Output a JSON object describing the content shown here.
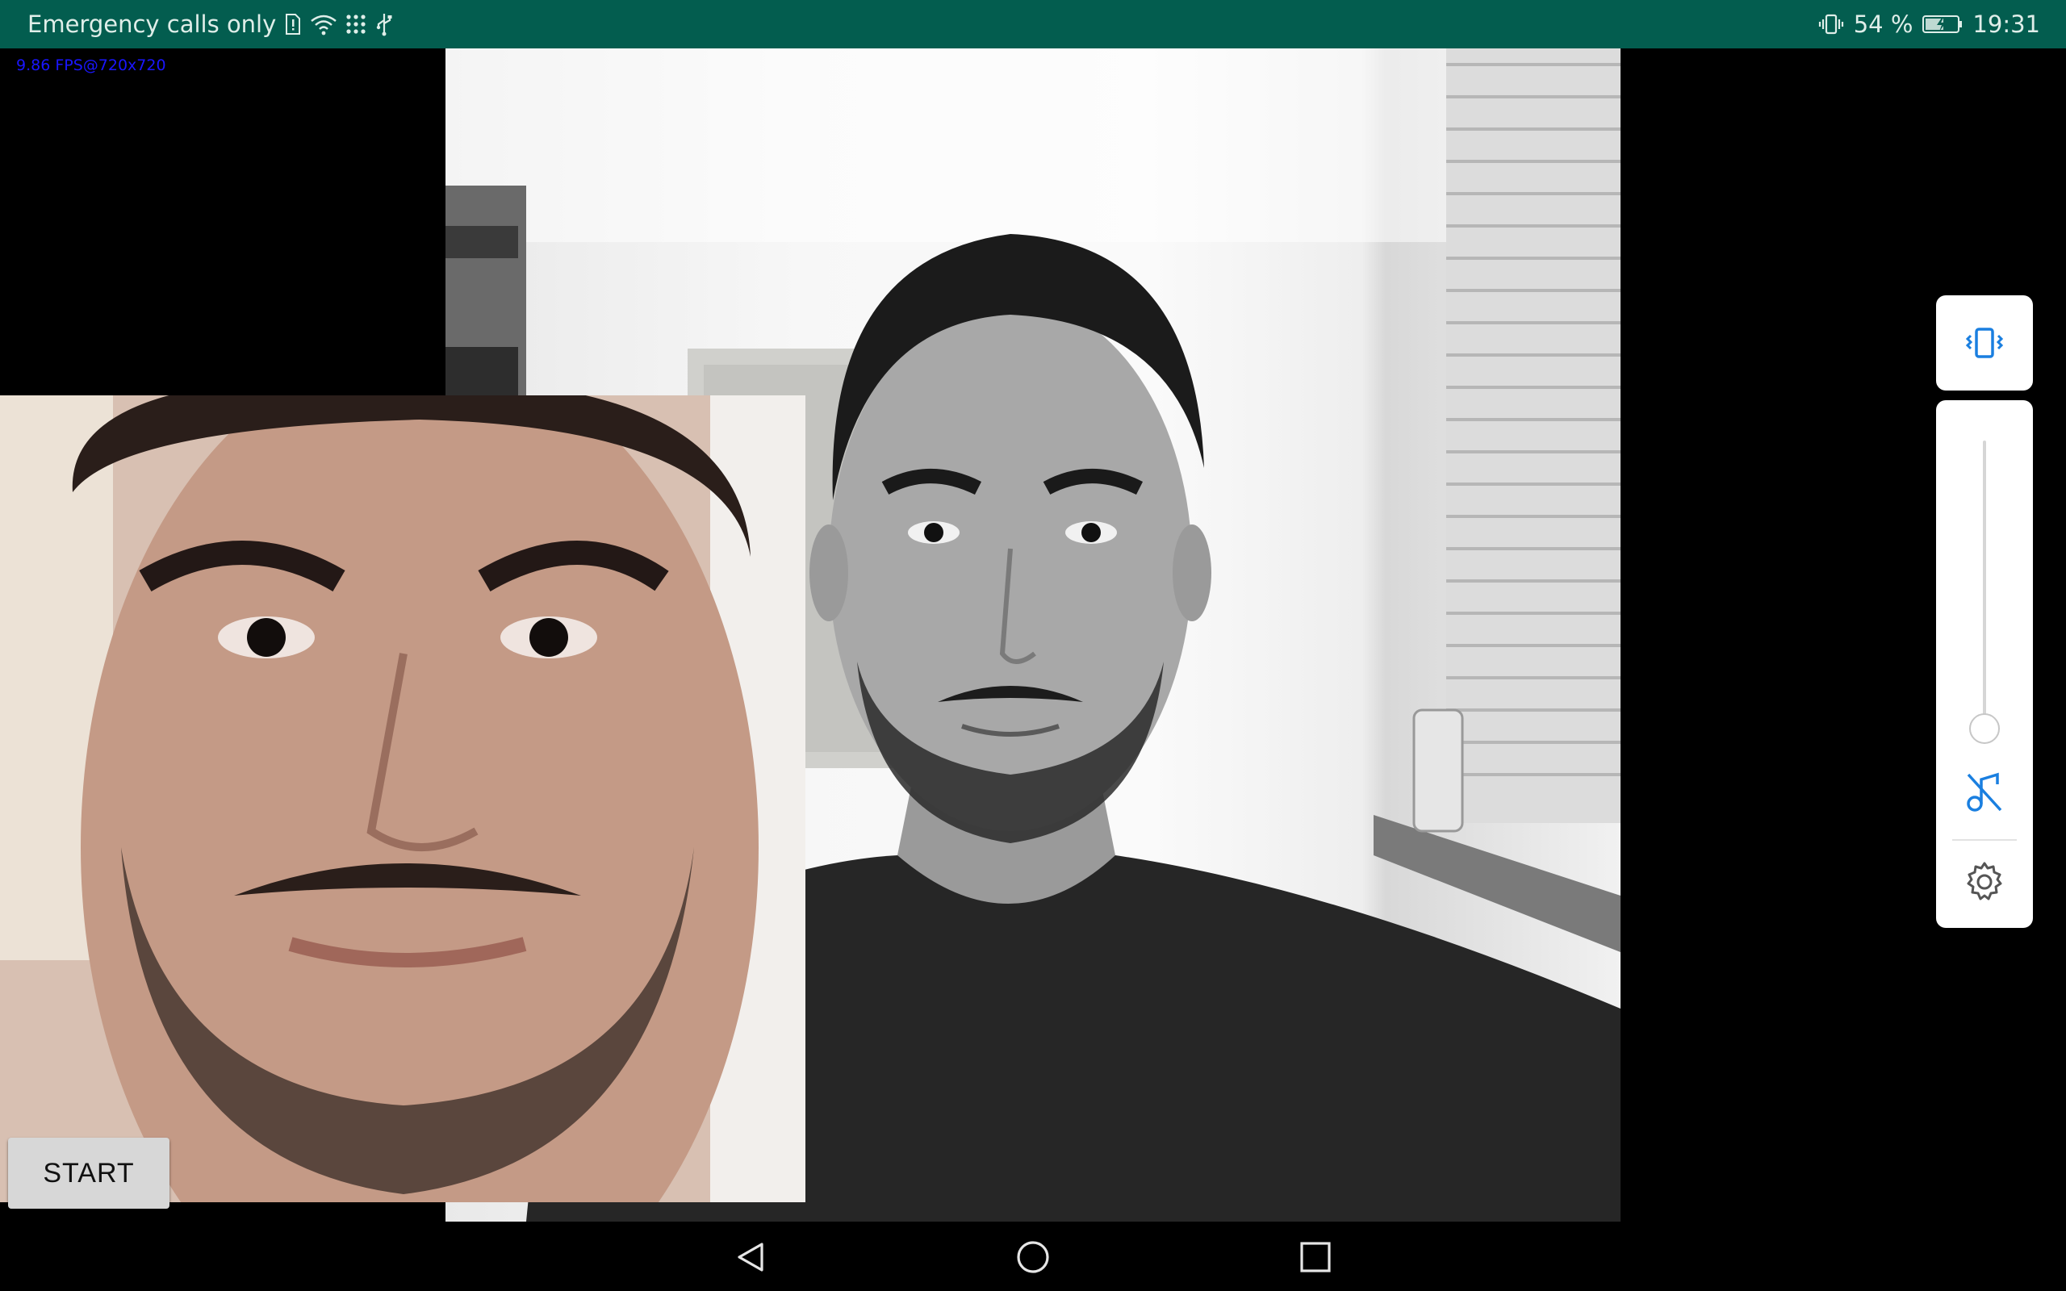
{
  "status_bar": {
    "carrier_text": "Emergency calls only",
    "battery_percent": "54 %",
    "time": "19:31",
    "icons": [
      "sim-alert-icon",
      "wifi-icon",
      "grid-dots-icon",
      "usb-icon",
      "vibrate-icon",
      "battery-charging-icon"
    ]
  },
  "overlay": {
    "fps_text": "9.86 FPS@720x720"
  },
  "controls": {
    "start_label": "START"
  },
  "volume_panel": {
    "ringer_mode_icon": "vibrate-icon",
    "volume_level": 0.0,
    "mute_icon": "music-off-icon",
    "settings_icon": "gear-icon"
  },
  "nav_bar": {
    "icons": [
      "back-icon",
      "home-icon",
      "recents-icon"
    ]
  },
  "colors": {
    "status_bar_bg": "#035d4f",
    "accent_blue": "#1a7fe0",
    "fps_text": "#1a16ff"
  }
}
